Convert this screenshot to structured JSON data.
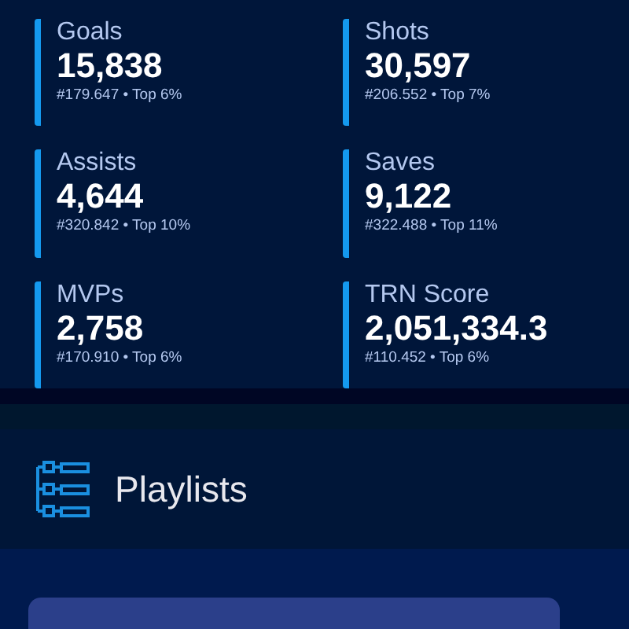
{
  "stats": [
    {
      "label": "Goals",
      "value": "15,838",
      "rank": "#179.647 • Top 6%"
    },
    {
      "label": "Shots",
      "value": "30,597",
      "rank": "#206.552 • Top 7%"
    },
    {
      "label": "Assists",
      "value": "4,644",
      "rank": "#320.842 • Top 10%"
    },
    {
      "label": "Saves",
      "value": "9,122",
      "rank": "#322.488 • Top 11%"
    },
    {
      "label": "MVPs",
      "value": "2,758",
      "rank": "#170.910 • Top 6%"
    },
    {
      "label": "TRN Score",
      "value": "2,051,334.3",
      "rank": "#110.452 • Top 6%"
    }
  ],
  "section": {
    "title": "Playlists"
  }
}
